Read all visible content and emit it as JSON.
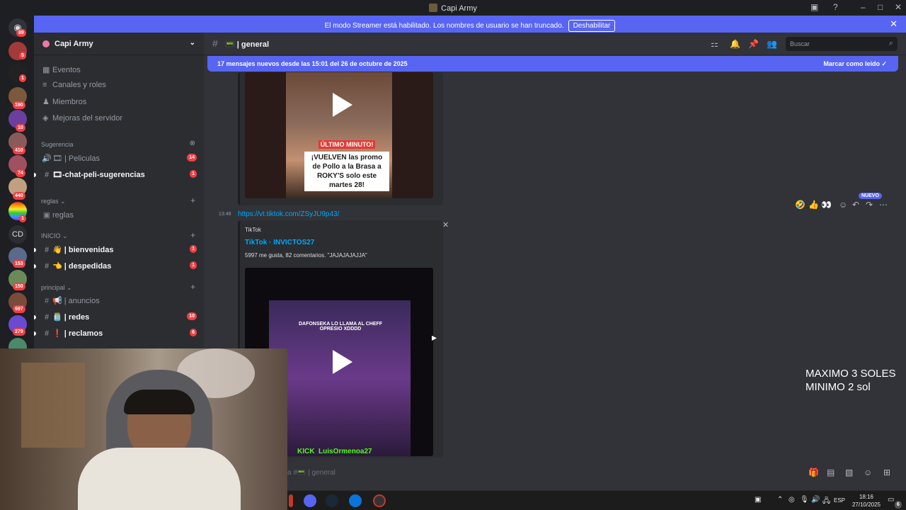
{
  "window": {
    "title": "Capi Army"
  },
  "banner": {
    "text": "El modo Streamer está habilitado. Los nombres de usuario se han truncado.",
    "button": "Deshabilitar"
  },
  "server_rail": {
    "items": [
      {
        "badge": "89"
      },
      {
        "badge": "5"
      },
      {
        "badge": "1"
      },
      {
        "badge": "190"
      },
      {
        "badge": "10"
      },
      {
        "badge": "410"
      },
      {
        "badge": "74"
      },
      {
        "badge": "440"
      },
      {
        "badge": "1"
      },
      {
        "label": "CD"
      },
      {
        "badge": "153"
      },
      {
        "badge": "150"
      },
      {
        "badge": "697"
      },
      {
        "badge": "279"
      }
    ]
  },
  "sidebar": {
    "server_name": "Capi Army",
    "menu": [
      "Eventos",
      "Canales y roles",
      "Miembros",
      "Mejoras del servidor"
    ],
    "categories": {
      "sugerencia": {
        "label": "Sugerencia",
        "channels": [
          {
            "name": "🎞 | Peliculas",
            "badge": "14"
          },
          {
            "name": "🎞-chat-peli-sugerencias",
            "badge": "1"
          }
        ]
      },
      "reglas": {
        "label": "reglas",
        "channels": [
          {
            "name": "reglas"
          }
        ]
      },
      "inicio": {
        "label": "INICIO",
        "channels": [
          {
            "name": "👋 | bienvenidas",
            "badge": "1"
          },
          {
            "name": "👈 | despedidas",
            "badge": "1"
          }
        ]
      },
      "principal": {
        "label": "principal",
        "channels": [
          {
            "name": "📢 | anuncios"
          },
          {
            "name": "🫙 | redes",
            "badge": "10"
          },
          {
            "name": "❗ | reclamos",
            "badge": "6"
          }
        ]
      }
    }
  },
  "channel_header": {
    "name": "| general",
    "search_placeholder": "Buscar"
  },
  "new_messages_bar": {
    "text": "17 mensajes nuevos desde las 15:01 del 26 de octubre de 2025",
    "action": "Marcar como leído"
  },
  "messages": {
    "video1": {
      "cap1": "ÚLTIMO MINUTO!",
      "cap2": "¡VUELVEN las promo de Pollo a la Brasa a ROKY'S solo este martes 28!"
    },
    "msg2": {
      "time": "13:48",
      "link": "https://vt.tiktok.com/ZSyJU9p43/",
      "provider": "TikTok",
      "title": "TikTok · INVICTOS27",
      "desc": "5997 me gusta, 82 comentarios. \"JAJAJAJAJJA\"",
      "video_caption": "DAFONSEKA LO LLAMA AL CHEFF OPRESIO XDDDD",
      "video_footer_kick": "KICK",
      "video_footer_name": "LuisOrmenoa27"
    },
    "new_label": "NUEVO"
  },
  "overlay": {
    "line1": "MAXIMO 3 SOLES",
    "line2": "MINIMO 2 sol"
  },
  "input": {
    "placeholder": "a #📟 | general"
  },
  "taskbar": {
    "lang": "ESP",
    "time": "18:16",
    "date": "27/10/2025",
    "notif": "6"
  }
}
